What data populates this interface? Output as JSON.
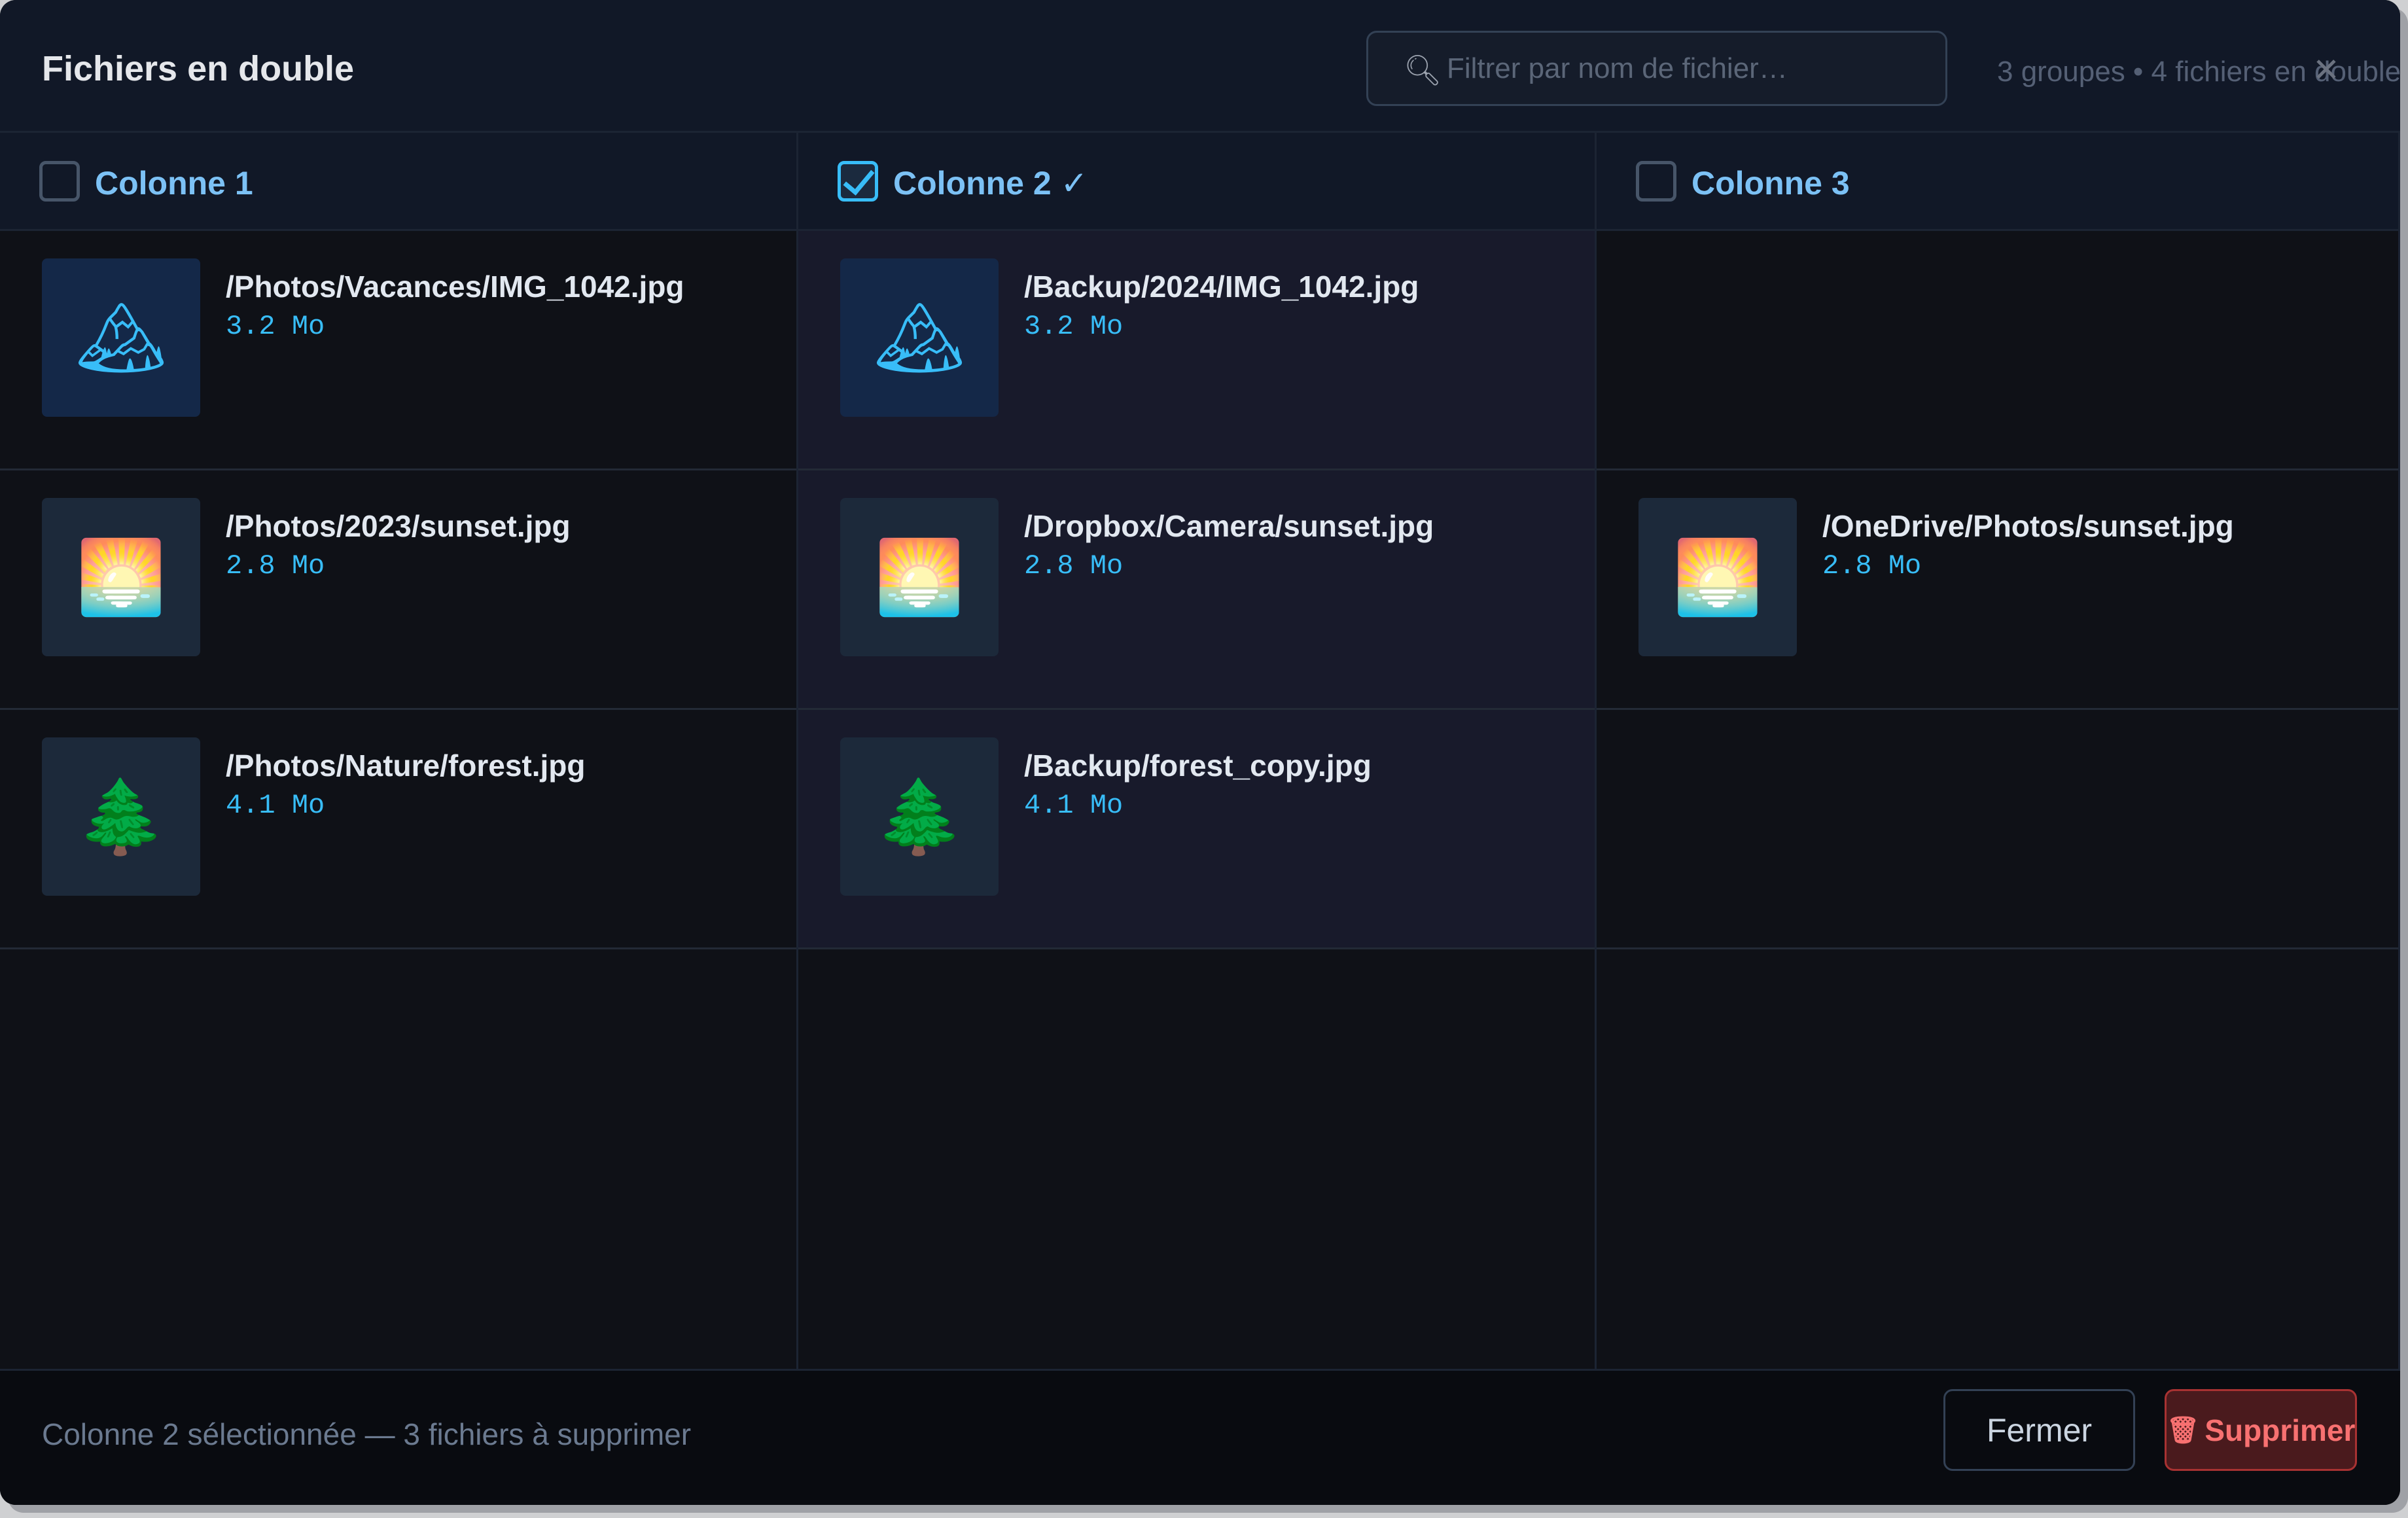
{
  "dialog": {
    "title": "Fichiers en double",
    "search_placeholder": "Filtrer par nom de fichier…",
    "search_value": "",
    "summary": "3 groupes • 4 fichiers en double",
    "close_glyph": "✕"
  },
  "columns": [
    {
      "label": "Colonne 1",
      "checked": false
    },
    {
      "label": "Colonne 2 ✓",
      "checked": true
    },
    {
      "label": "Colonne 3",
      "checked": false
    }
  ],
  "rows": [
    [
      {
        "icon": "mountain-icon",
        "path": "/Photos/Vacances/IMG_1042.jpg",
        "size": "3.2 Mo"
      },
      {
        "icon": "mountain-icon",
        "path": "/Backup/2024/IMG_1042.jpg",
        "size": "3.2 Mo"
      },
      null
    ],
    [
      {
        "icon": "sunrise-icon",
        "path": "/Photos/2023/sunset.jpg",
        "size": "2.8 Mo"
      },
      {
        "icon": "sunrise-icon",
        "path": "/Dropbox/Camera/sunset.jpg",
        "size": "2.8 Mo"
      },
      {
        "icon": "sunrise-icon",
        "path": "/OneDrive/Photos/sunset.jpg",
        "size": "2.8 Mo"
      }
    ],
    [
      {
        "icon": "tree-icon",
        "path": "/Photos/Nature/forest.jpg",
        "size": "4.1 Mo"
      },
      {
        "icon": "tree-icon",
        "path": "/Backup/forest_copy.jpg",
        "size": "4.1 Mo"
      },
      null
    ]
  ],
  "footer": {
    "status": "Colonne 2 sélectionnée — 3 fichiers à supprimer",
    "close_label": "Fermer",
    "delete_label": "Supprimer",
    "trash_glyph": "🗑"
  },
  "colors": {
    "accent": "#38bdf8",
    "danger": "#f87171"
  }
}
